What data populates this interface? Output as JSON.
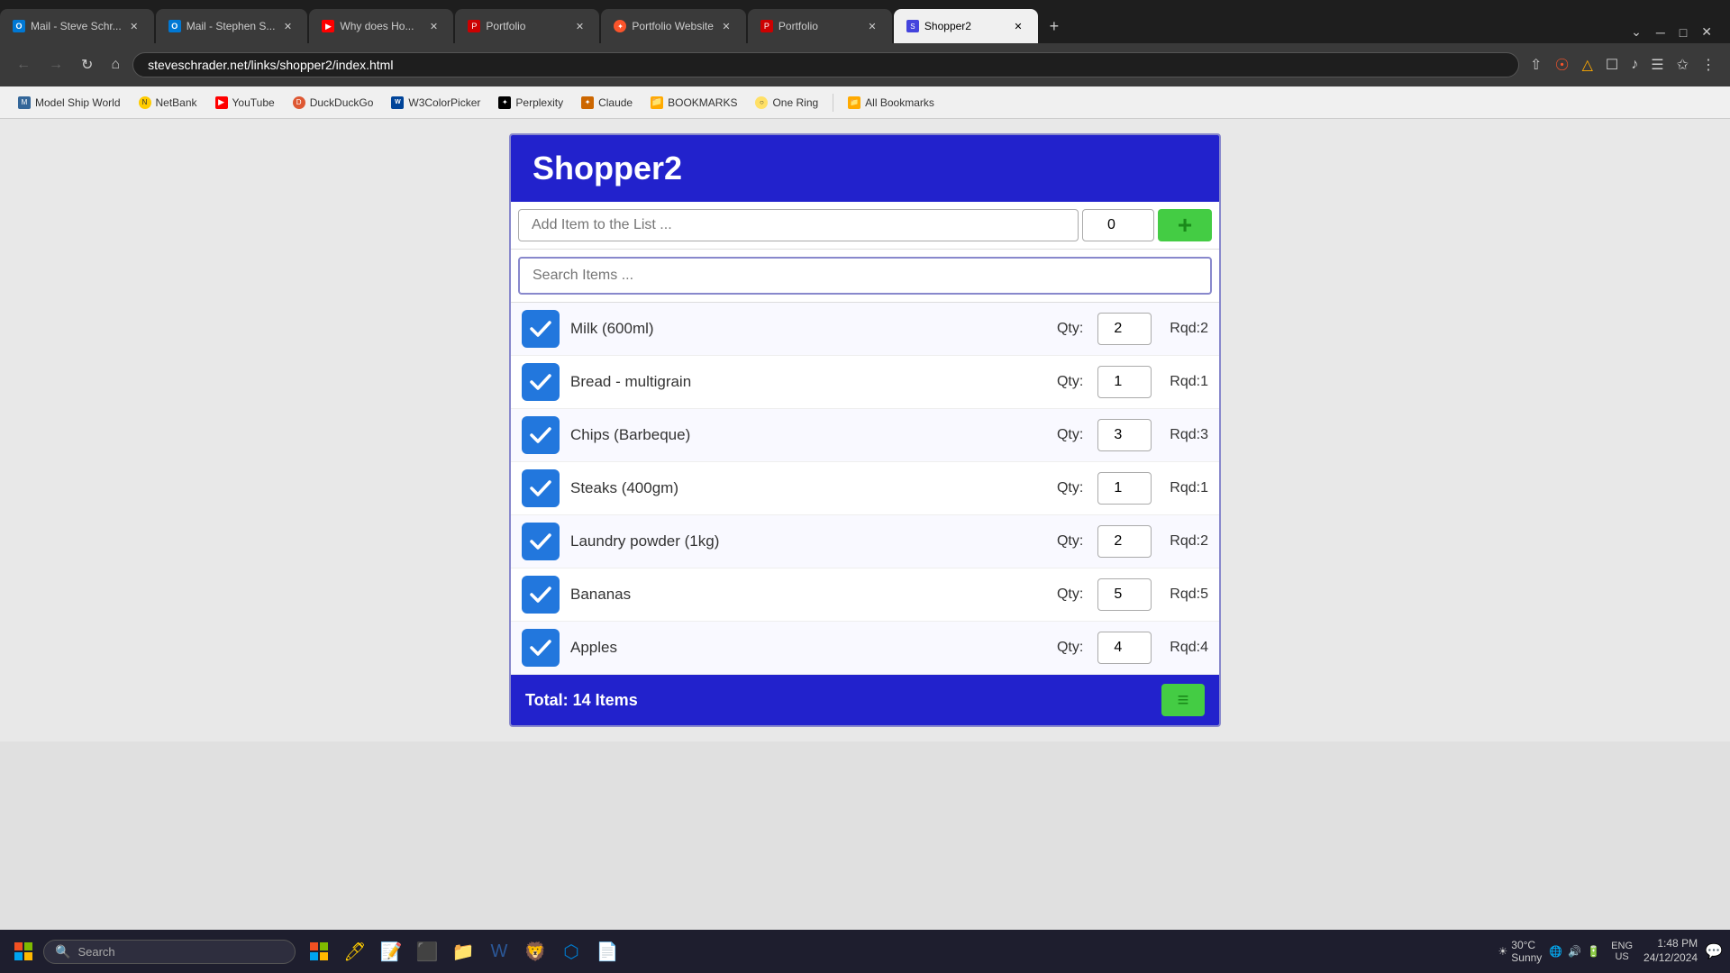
{
  "browser": {
    "url": "steveschrader.net/links/shopper2/index.html",
    "tabs": [
      {
        "id": "tab-mail-steve",
        "favicon": "outlook",
        "title": "Mail - Steve Schr...",
        "active": false,
        "closable": true
      },
      {
        "id": "tab-mail-stephen",
        "favicon": "outlook",
        "title": "Mail - Stephen S...",
        "active": false,
        "closable": true
      },
      {
        "id": "tab-youtube",
        "favicon": "youtube",
        "title": "Why does Ho...",
        "active": false,
        "closable": true
      },
      {
        "id": "tab-portfolio1",
        "favicon": "portfolio",
        "title": "Portfolio",
        "active": false,
        "closable": true
      },
      {
        "id": "tab-portfolio-web",
        "favicon": "brave",
        "title": "Portfolio Website",
        "active": false,
        "closable": true
      },
      {
        "id": "tab-portfolio2",
        "favicon": "portfolio",
        "title": "Portfolio",
        "active": false,
        "closable": true
      },
      {
        "id": "tab-shopper",
        "favicon": "shopper",
        "title": "Shopper2",
        "active": true,
        "closable": true
      }
    ],
    "bookmarks": [
      {
        "id": "bm-modelship",
        "favicon": "modelship",
        "title": "Model Ship World"
      },
      {
        "id": "bm-netbank",
        "favicon": "netbank",
        "title": "NetBank"
      },
      {
        "id": "bm-youtube",
        "favicon": "youtube",
        "title": "YouTube"
      },
      {
        "id": "bm-duckduckgo",
        "favicon": "duckduckgo",
        "title": "DuckDuckGo"
      },
      {
        "id": "bm-w3",
        "favicon": "w3",
        "title": "W3ColorPicker"
      },
      {
        "id": "bm-perplexity",
        "favicon": "perplexity",
        "title": "Perplexity"
      },
      {
        "id": "bm-claude",
        "favicon": "claude",
        "title": "Claude"
      },
      {
        "id": "bm-bookmarks",
        "favicon": "bookmark",
        "title": "BOOKMARKS"
      },
      {
        "id": "bm-onering",
        "favicon": "onering",
        "title": "One Ring"
      },
      {
        "id": "bm-allbookmarks",
        "favicon": "allbookmarks",
        "title": "All Bookmarks"
      }
    ]
  },
  "app": {
    "title": "Shopper2",
    "add_placeholder": "Add Item to the List ...",
    "add_qty": "0",
    "search_placeholder": "Search Items ...",
    "items": [
      {
        "name": "Milk (600ml)",
        "qty": "2",
        "rqd": "2",
        "checked": true
      },
      {
        "name": "Bread - multigrain",
        "qty": "1",
        "rqd": "1",
        "checked": true
      },
      {
        "name": "Chips (Barbeque)",
        "qty": "3",
        "rqd": "3",
        "checked": true
      },
      {
        "name": "Steaks (400gm)",
        "qty": "1",
        "rqd": "1",
        "checked": true
      },
      {
        "name": "Laundry powder (1kg)",
        "qty": "2",
        "rqd": "2",
        "checked": true
      },
      {
        "name": "Bananas",
        "qty": "5",
        "rqd": "5",
        "checked": true
      },
      {
        "name": "Apples",
        "qty": "4",
        "rqd": "4",
        "checked": true
      }
    ],
    "footer": {
      "total": "Total: 14 Items"
    }
  },
  "taskbar": {
    "search_placeholder": "Search",
    "weather": "30°C",
    "weather_condition": "Sunny",
    "time": "1:48 PM",
    "date": "24/12/2024",
    "locale": "ENG\nUS"
  }
}
